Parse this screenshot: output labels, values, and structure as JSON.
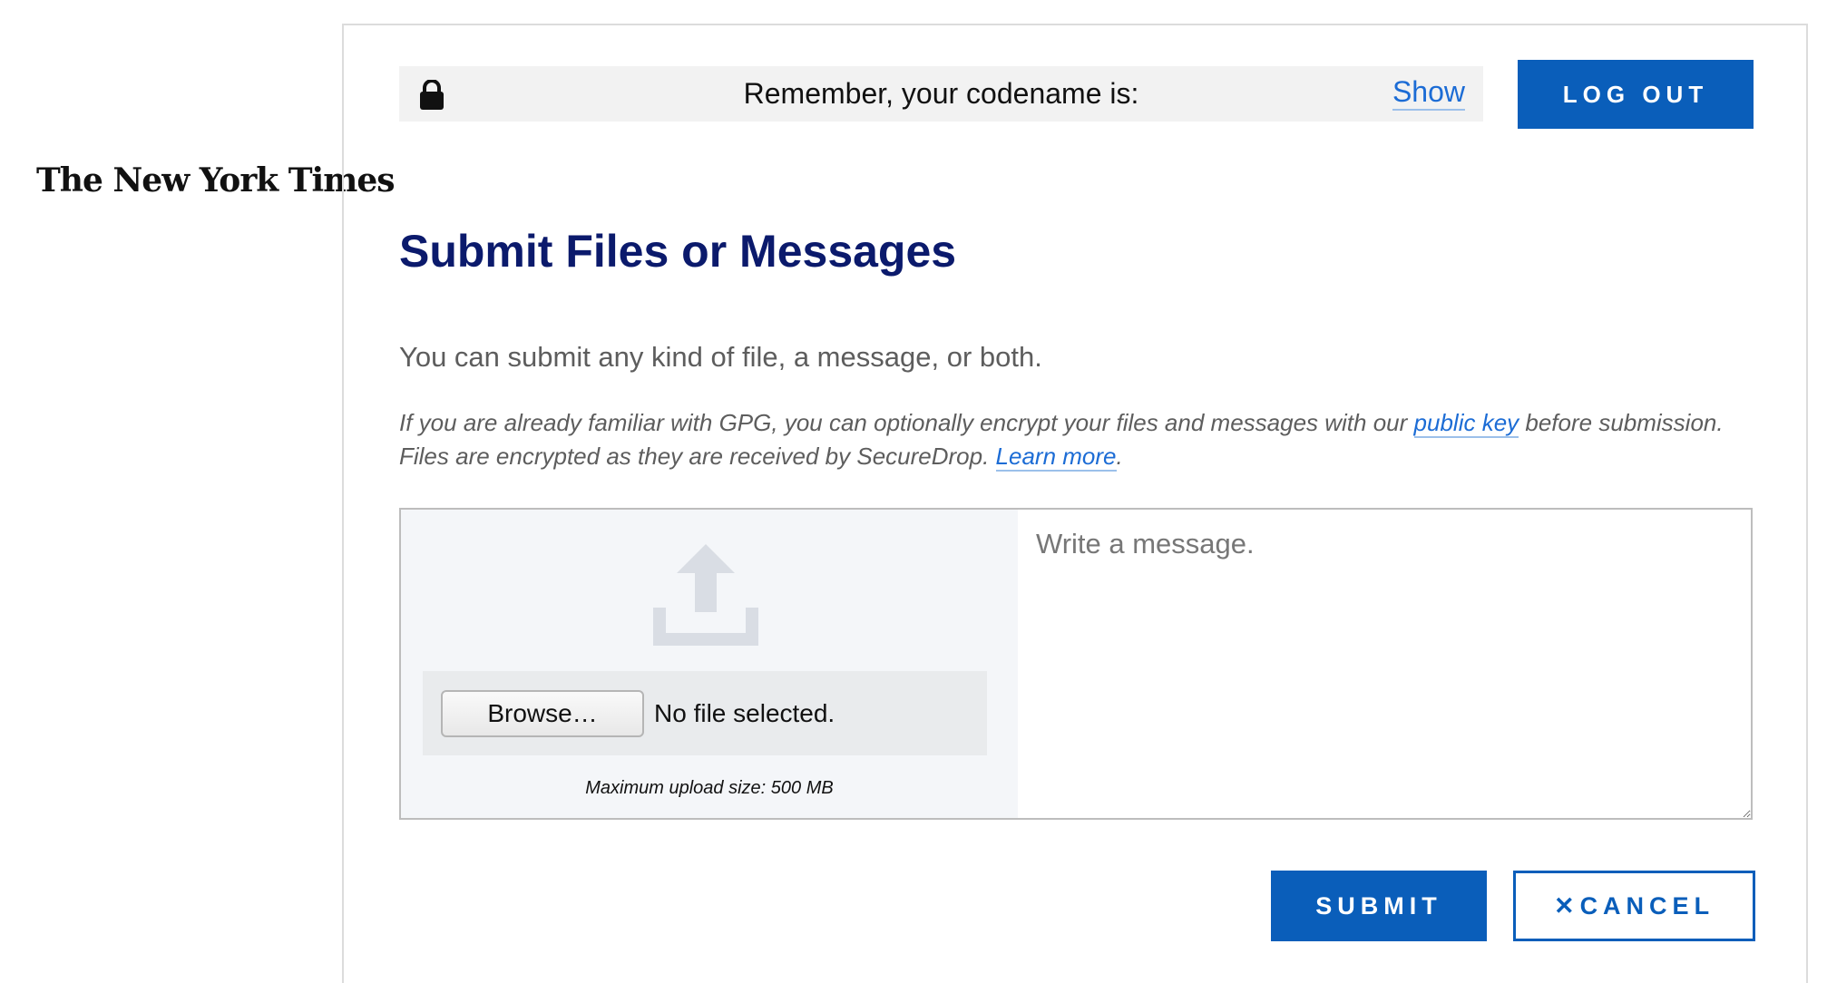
{
  "branding": {
    "logo_text": "The New York Times"
  },
  "codename_bar": {
    "icon": "lock-icon",
    "text": "Remember, your codename is:",
    "show_link": "Show"
  },
  "header": {
    "logout_label": "LOG OUT"
  },
  "main": {
    "title": "Submit Files or Messages",
    "intro": "You can submit any kind of file, a message, or both.",
    "gpg_note_part1": "If you are already familiar with GPG, you can optionally encrypt your files and messages with our ",
    "public_key_link": "public key",
    "gpg_note_part2": " before submission. Files are encrypted as they are received by SecureDrop. ",
    "learn_more_link": "Learn more",
    "gpg_note_part3": "."
  },
  "upload": {
    "icon": "upload-icon",
    "browse_label": "Browse…",
    "file_status": "No file selected.",
    "max_size": "Maximum upload size: 500 MB"
  },
  "message": {
    "placeholder": "Write a message.",
    "value": ""
  },
  "actions": {
    "submit_label": "SUBMIT",
    "cancel_icon": "close-icon",
    "cancel_label": "CANCEL"
  },
  "colors": {
    "accent": "#0a5eba",
    "title": "#0b1a6c",
    "link": "#1c6cd5",
    "codename_bar_bg": "#f2f2f2",
    "upload_area_bg": "#f4f6f9"
  }
}
